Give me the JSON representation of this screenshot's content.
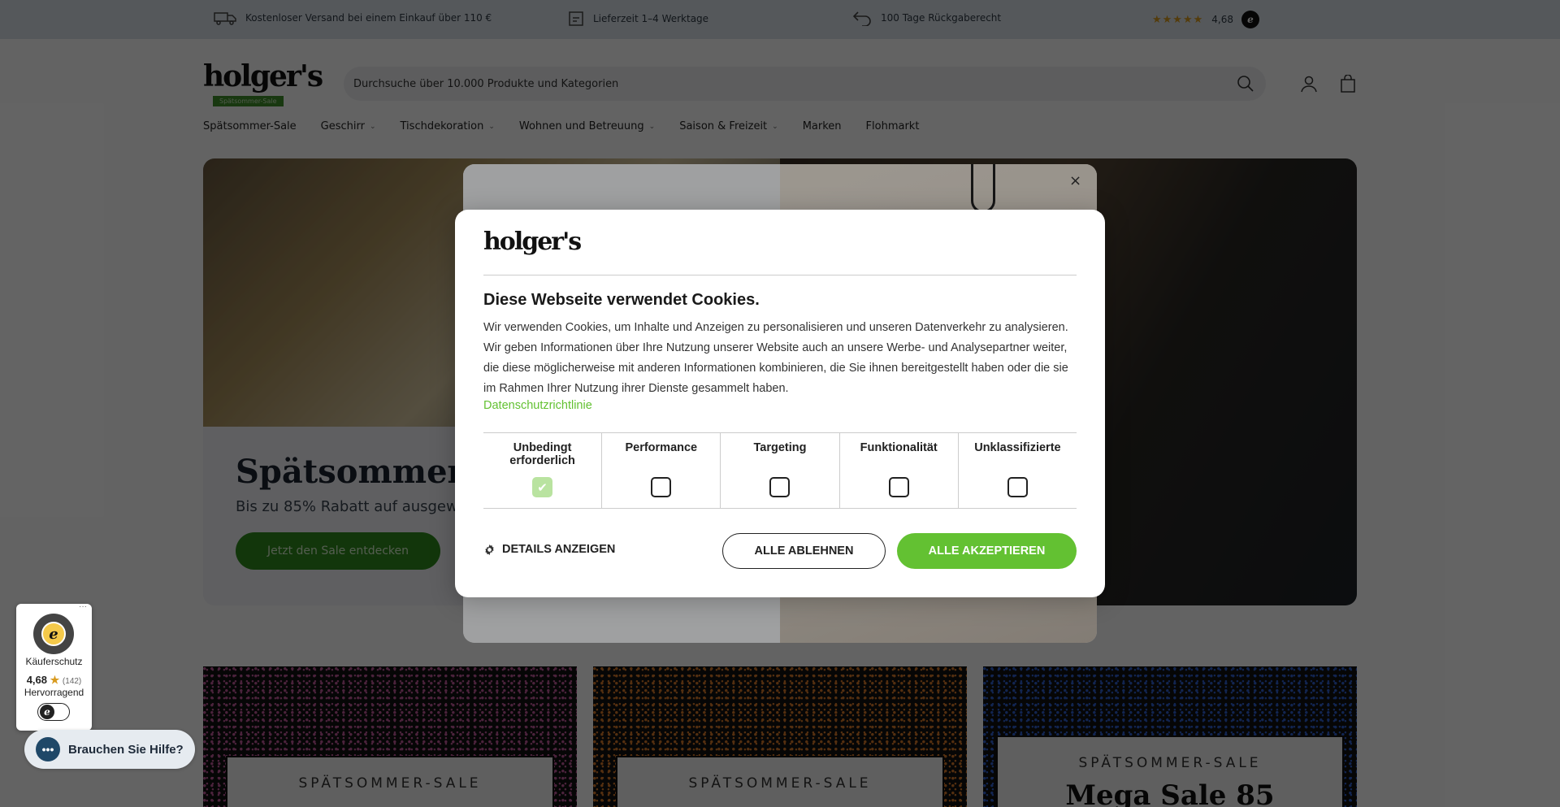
{
  "topbar": {
    "shipping": "Kostenloser Versand bei einem Einkauf über 110 €",
    "delivery": "Lieferzeit 1–4 Werktage",
    "returns": "100 Tage Rückgaberecht",
    "stars": "★★★★★",
    "rating": "4,68",
    "badge": "e"
  },
  "header": {
    "logo": "holger's",
    "logo_tag": "Spätsommer-Sale",
    "search_placeholder": "Durchsuche über 10.000 Produkte und Kategorien"
  },
  "nav": {
    "items": [
      {
        "label": "Spätsommer-Sale"
      },
      {
        "label": "Geschirr"
      },
      {
        "label": "Tischdekoration"
      },
      {
        "label": "Wohnen und Betreuung"
      },
      {
        "label": "Saison & Freizeit"
      },
      {
        "label": "Marken"
      },
      {
        "label": "Flohmarkt"
      }
    ]
  },
  "hero": {
    "title": "Spätsommer-",
    "subtitle": "Bis zu 85% Rabatt auf ausgewä",
    "cta": "Jetzt den Sale entdecken"
  },
  "tiles": [
    {
      "label": "SPÄTSOMMER-SALE",
      "color": "#c15a9a"
    },
    {
      "label": "SPÄTSOMMER-SALE",
      "color": "#d97b2a"
    },
    {
      "label": "SPÄTSOMMER-SALE",
      "big": "Mega Sale 85",
      "color": "#2f5fd0"
    }
  ],
  "promo": {
    "close": "×"
  },
  "cookie": {
    "logo": "holger's",
    "title": "Diese Webseite verwendet Cookies.",
    "text": "Wir verwenden Cookies, um Inhalte und Anzeigen zu personalisieren und unseren Datenverkehr zu analysieren. Wir geben Informationen über Ihre Nutzung unserer Website auch an unsere Werbe- und Analysepartner weiter, die diese möglicherweise mit anderen Informationen kombinieren, die Sie ihnen bereitgestellt haben oder die sie im Rahmen Ihrer Nutzung ihrer Dienste gesammelt haben.",
    "link": "Datenschutzrichtlinie",
    "categories": [
      {
        "label": "Unbedingt erforderlich",
        "checked": true
      },
      {
        "label": "Performance",
        "checked": false
      },
      {
        "label": "Targeting",
        "checked": false
      },
      {
        "label": "Funktionalität",
        "checked": false
      },
      {
        "label": "Unklassifizierte",
        "checked": false
      }
    ],
    "details": "DETAILS ANZEIGEN",
    "decline": "ALLE ABLEHNEN",
    "accept": "ALLE AKZEPTIEREN",
    "accent": "#63c132"
  },
  "trusted": {
    "protection": "Käuferschutz",
    "rating": "4,68",
    "count": "(142)",
    "verdict": "Hervorragend",
    "more": "···"
  },
  "help": {
    "label": "Brauchen Sie Hilfe?"
  }
}
